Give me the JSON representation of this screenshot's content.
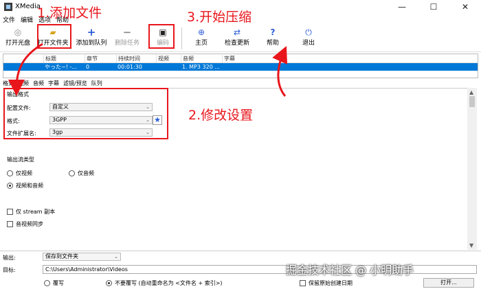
{
  "window": {
    "title": "XMedia",
    "minimize": "—",
    "maximize": "☐",
    "close": "✕"
  },
  "menu": [
    "文件",
    "编辑",
    "选项",
    "帮助"
  ],
  "toolbar": {
    "open_disc": "打开光盘",
    "open_folder": "打开文件夹",
    "add_queue": "添加到队列",
    "delete_task": "删除任务",
    "encode": "编码",
    "home": "主页",
    "check_update": "检查更新",
    "help": "帮助",
    "exit": "退出"
  },
  "queue": {
    "headers": [
      "标题",
      "章节",
      "持续时间",
      "视频",
      "音频",
      "字幕"
    ],
    "row": [
      "やった~! -...",
      "0",
      "00:01:30",
      "",
      "1. MP3 320 ...",
      ""
    ]
  },
  "tabs": [
    "格式",
    "视频",
    "音频",
    "字幕",
    "滤镜/预览",
    "队列"
  ],
  "format": {
    "group_title": "输出格式",
    "profile_label": "配置文件:",
    "profile_value": "自定义",
    "format_label": "格式:",
    "format_value": "3GPP",
    "ext_label": "文件扩展名:",
    "ext_value": "3gp"
  },
  "stream": {
    "group_title": "输出流类型",
    "video_only": "仅视频",
    "audio_only": "仅音频",
    "video_audio": "视频和音频",
    "selected": "video_audio",
    "stream_copy": "仅 stream 副本",
    "av_sync": "音视频同步"
  },
  "output": {
    "output_label": "输出:",
    "output_value": "保存到文件夹",
    "target_label": "目标:",
    "target_path": "C:\\Users\\Administrator\\Videos",
    "overwrite": "覆写",
    "no_overwrite": "不要覆写 (自动重命名为 <文件名 + 索引>)",
    "keep_date": "保留原始创建日期",
    "open_button": "打开..."
  },
  "annotations": {
    "step1": "1.添加文件",
    "step2": "2.修改设置",
    "step3": "3.开始压缩"
  },
  "watermark": "掘金技术社区 @ 小明助手",
  "colors": {
    "annotation_red": "#e8151b",
    "selection_blue": "#0078d7",
    "icon_blue": "#2a5bd7"
  }
}
